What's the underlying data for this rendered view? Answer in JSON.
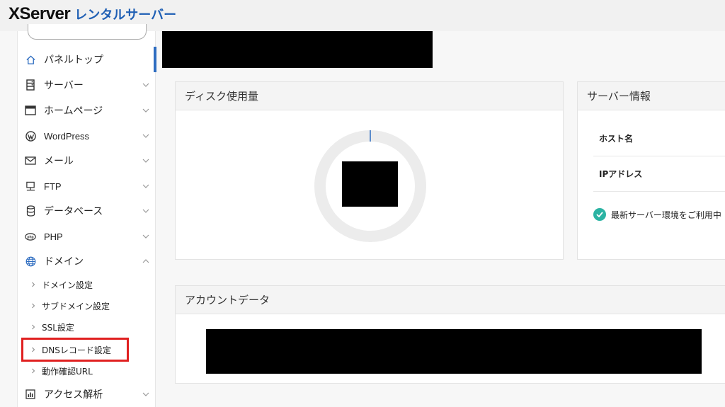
{
  "header": {
    "logo_primary": "XServer",
    "logo_secondary": "レンタルサーバー"
  },
  "sidebar": {
    "items": [
      {
        "label": "パネルトップ",
        "icon": "home-icon",
        "active": true
      },
      {
        "label": "サーバー",
        "icon": "server-icon"
      },
      {
        "label": "ホームページ",
        "icon": "browser-window-icon"
      },
      {
        "label": "WordPress",
        "icon": "wordpress-icon"
      },
      {
        "label": "メール",
        "icon": "mail-icon"
      },
      {
        "label": "FTP",
        "icon": "ftp-icon"
      },
      {
        "label": "データベース",
        "icon": "database-icon"
      },
      {
        "label": "PHP",
        "icon": "php-icon"
      },
      {
        "label": "ドメイン",
        "icon": "globe-icon",
        "expanded": true
      },
      {
        "label": "アクセス解析",
        "icon": "analytics-icon"
      }
    ],
    "domain_subitems": [
      {
        "label": "ドメイン設定"
      },
      {
        "label": "サブドメイン設定"
      },
      {
        "label": "SSL設定"
      },
      {
        "label": "DNSレコード設定",
        "highlighted": true
      },
      {
        "label": "動作確認URL"
      }
    ]
  },
  "disk_card": {
    "title": "ディスク使用量"
  },
  "server_info_card": {
    "title": "サーバー情報",
    "rows": [
      {
        "label": "ホスト名"
      },
      {
        "label": "IPアドレス"
      }
    ],
    "notice": "最新サーバー環境をご利用中"
  },
  "account_card": {
    "title": "アカウントデータ"
  },
  "colors": {
    "brand_blue": "#1f5fb4",
    "active_bar": "#2d6cc0",
    "highlight_red": "#e02020",
    "check_teal": "#2bb3a3"
  }
}
